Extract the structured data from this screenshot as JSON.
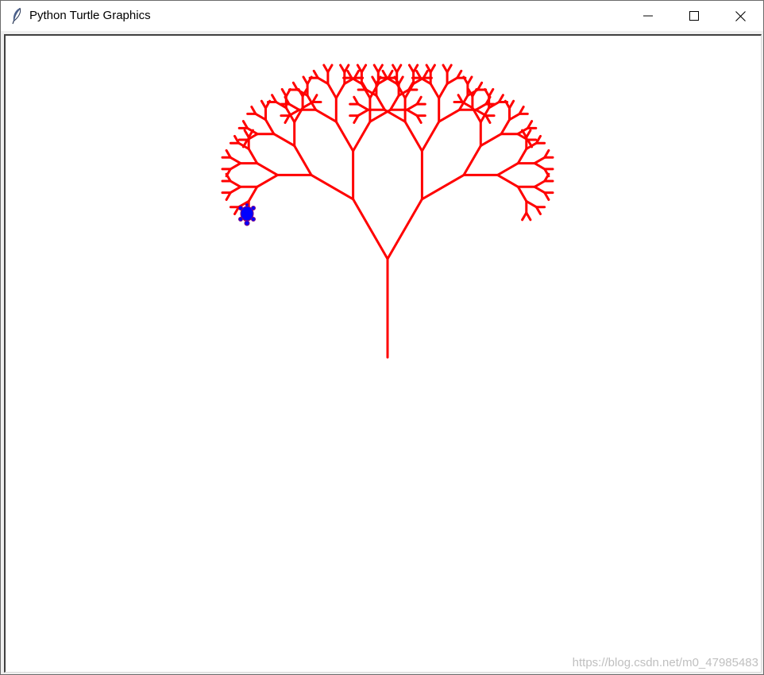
{
  "window": {
    "title": "Python Turtle Graphics",
    "app_icon": "feather-icon",
    "controls": {
      "minimize_icon": "minimize-icon",
      "maximize_icon": "maximize-icon",
      "close_icon": "close-icon"
    }
  },
  "canvas": {
    "background": "#ffffff",
    "pen_color": "#ff0000",
    "turtle_color": "#0000ff",
    "turtle_outline": "#800080",
    "turtle_shape": "turtle",
    "tree": {
      "trunk_length": 124,
      "min_branch": 10,
      "branch_angle_deg": 30,
      "length_ratio": 0.7
    }
  },
  "watermark": "https://blog.csdn.net/m0_47985483"
}
